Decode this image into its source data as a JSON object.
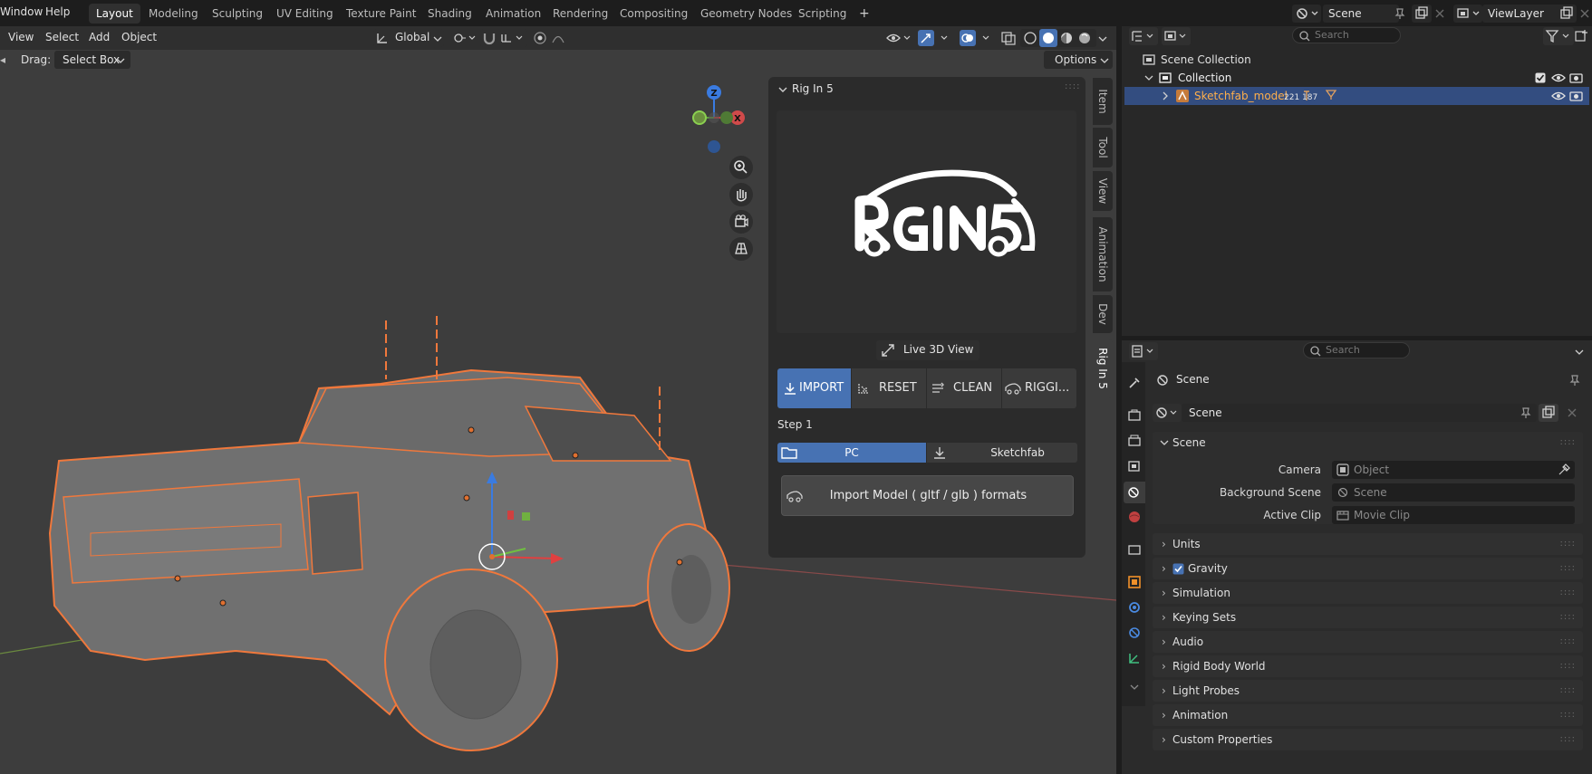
{
  "topbar": {
    "menus": [
      "Window",
      "Help"
    ],
    "workspaces": [
      "Layout",
      "Modeling",
      "Sculpting",
      "UV Editing",
      "Texture Paint",
      "Shading",
      "Animation",
      "Rendering",
      "Compositing",
      "Geometry Nodes",
      "Scripting"
    ],
    "active_workspace": "Layout",
    "scene_name": "Scene",
    "view_layer": "ViewLayer",
    "add_tab_symbol": "+"
  },
  "viewport": {
    "menus": [
      "View",
      "Select",
      "Add",
      "Object"
    ],
    "transform_orientation": "Global",
    "drag_label": "Drag:",
    "drag_value": "Select Box",
    "options_label": "Options",
    "gizmo_axes": {
      "z": "Z",
      "x": "X"
    },
    "accent_orange": "#f0783c"
  },
  "npanel": {
    "title": "Rig In 5",
    "logo_text": "RigIn5",
    "live_view_label": "Live 3D View",
    "tools": [
      "IMPORT",
      "RESET",
      "CLEAN",
      "RIGGI..."
    ],
    "active_tool": "IMPORT",
    "step_label": "Step 1",
    "sources": [
      "PC",
      "Sketchfab"
    ],
    "active_source": "PC",
    "import_button": "Import Model ( gltf / glb ) formats",
    "side_tabs": [
      "Item",
      "Tool",
      "View",
      "Animation",
      "Dev",
      "Rig In 5"
    ],
    "active_side_tab": "Rig In 5"
  },
  "outliner": {
    "search_placeholder": "Search",
    "root": "Scene Collection",
    "collection": "Collection",
    "object": "Sketchfab_model",
    "object_badges": "221 187",
    "selected_color": "#334d80"
  },
  "properties": {
    "search_placeholder": "Search",
    "context_title": "Scene",
    "datablock": "Scene",
    "panel_title": "Scene",
    "fields": [
      {
        "label": "Camera",
        "value": "Object"
      },
      {
        "label": "Background Scene",
        "value": "Scene"
      },
      {
        "label": "Active Clip",
        "value": "Movie Clip"
      }
    ],
    "sections": [
      "Units",
      "Gravity",
      "Simulation",
      "Keying Sets",
      "Audio",
      "Rigid Body World",
      "Light Probes",
      "Animation",
      "Custom Properties"
    ],
    "gravity_checked": true,
    "grip": "::::"
  }
}
